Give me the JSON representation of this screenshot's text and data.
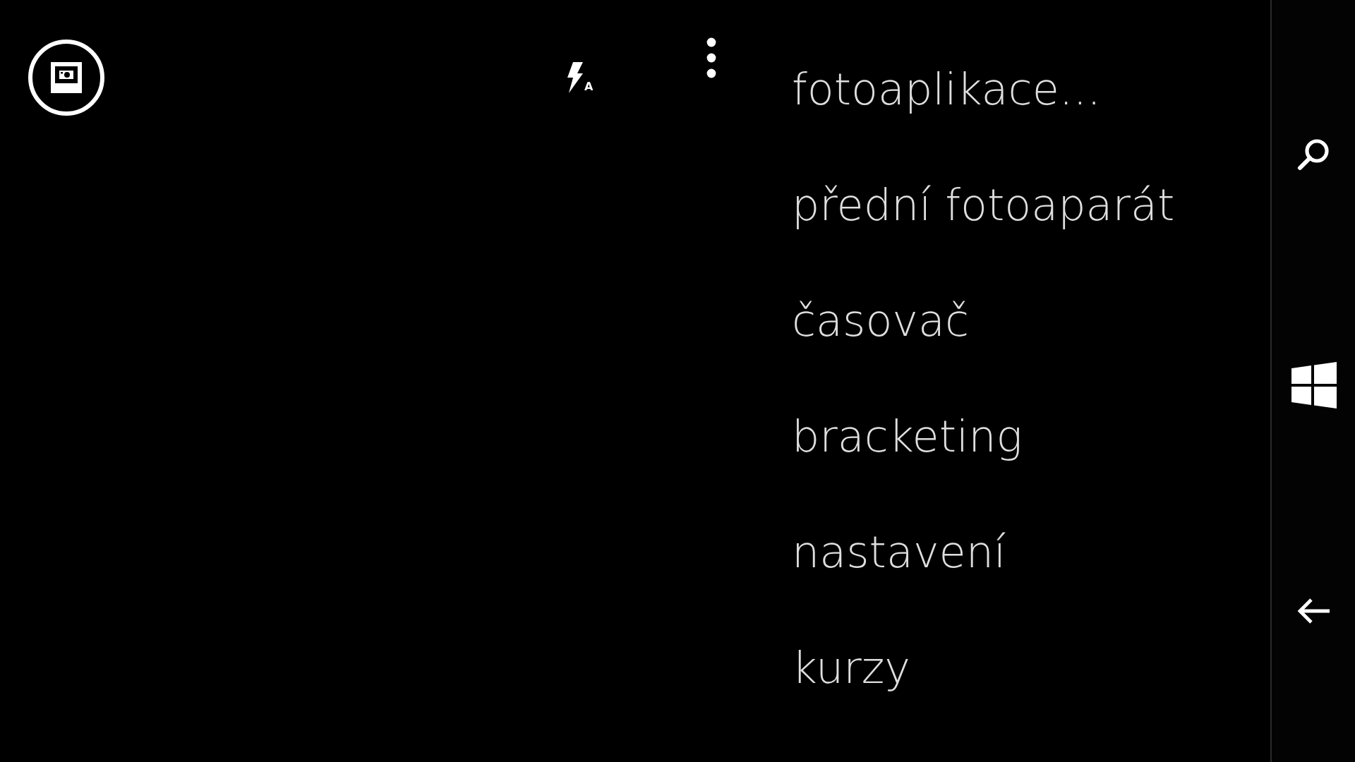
{
  "toolbar": {
    "flash_mode": "A"
  },
  "menu": {
    "items": [
      {
        "label": "fotoaplikace..."
      },
      {
        "label": "přední fotoaparát"
      },
      {
        "label": "časovač"
      },
      {
        "label": "bracketing"
      },
      {
        "label": "nastavení"
      },
      {
        "label": "kurzy"
      }
    ]
  }
}
